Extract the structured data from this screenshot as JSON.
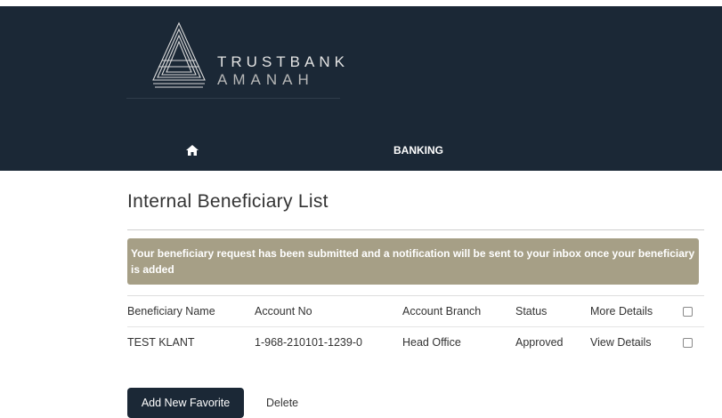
{
  "brand": {
    "name": "TRUSTBANK",
    "sub": "AMANAH"
  },
  "nav": {
    "home_icon": "home-icon",
    "banking_label": "BANKING"
  },
  "page": {
    "title": "Internal Beneficiary List"
  },
  "alert": {
    "message": "Your beneficiary request has been submitted and a notification will be sent to your inbox once your beneficiary is added"
  },
  "table": {
    "headers": {
      "name": "Beneficiary Name",
      "account": "Account No",
      "branch": "Account Branch",
      "status": "Status",
      "details": "More Details"
    },
    "rows": [
      {
        "name": "TEST KLANT",
        "account": "1-968-210101-1239-0",
        "branch": "Head Office",
        "status": "Approved",
        "details": "View Details"
      }
    ]
  },
  "actions": {
    "add_label": "Add New Favorite",
    "delete_label": "Delete"
  },
  "colors": {
    "header_bg": "#1b2836",
    "alert_bg": "#a69f86",
    "button_bg": "#1b2836"
  }
}
